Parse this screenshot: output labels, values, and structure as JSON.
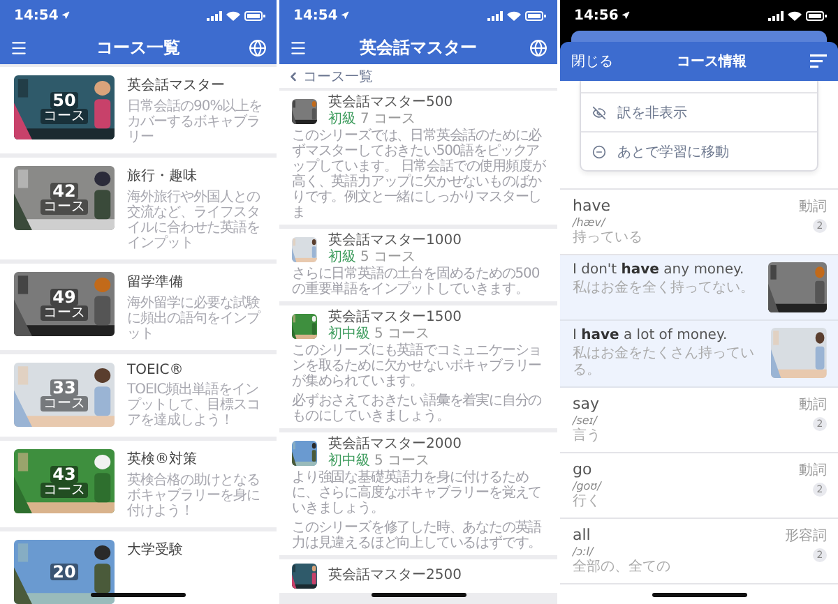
{
  "course_list": {
    "status_bar": {
      "time": "14:54"
    },
    "header": {
      "title": "コース一覧"
    },
    "courses": [
      {
        "title": "英会話マスター",
        "description": "日常会話の90%以上をカバーするボキャブラリー",
        "count": "50",
        "unit": "コース"
      },
      {
        "title": "旅行・趣味",
        "description": "海外旅行や外国人との交流など、ライフスタイルに合わせた英語をインプット",
        "count": "42",
        "unit": "コース"
      },
      {
        "title": "留学準備",
        "description": "海外留学に必要な試験に頻出の語句をインプット",
        "count": "49",
        "unit": "コース"
      },
      {
        "title": "TOEIC®",
        "description": "TOEIC頻出単語をインプットして、目標スコアを達成しよう！",
        "count": "33",
        "unit": "コース"
      },
      {
        "title": "英検®対策",
        "description": "英検合格の助けとなるボキャブラリーを身に付けよう！",
        "count": "43",
        "unit": "コース"
      },
      {
        "title": "大学受験",
        "count": "20"
      }
    ]
  },
  "series_screen": {
    "status_bar": {
      "time": "14:54"
    },
    "header": {
      "title": "英会話マスター"
    },
    "back_link": "コース一覧",
    "series": [
      {
        "title": "英会話マスター500",
        "level": "初級",
        "count": "7 コース",
        "paragraphs": [
          "このシリーズでは、日常英会話のために必ずマスターしておきたい500語をピックアップしています。 日常会話での使用頻度が高く、英語力アップに欠かせないものばかりです。例文と一緒にしっかりマスターしま"
        ]
      },
      {
        "title": "英会話マスター1000",
        "level": "初級",
        "count": "5 コース",
        "paragraphs": [
          "さらに日常英語の土台を固めるための500の重要単語をインプットしていきます。"
        ]
      },
      {
        "title": "英会話マスター1500",
        "level": "初中級",
        "count": "5 コース",
        "paragraphs": [
          "このシリーズにも英語でコミュニケーションを取るために欠かせないボキャブラリーが集められています。",
          "必ずおさえておきたい語彙を着実に自分のものにしていきましょう。"
        ]
      },
      {
        "title": "英会話マスター2000",
        "level": "初中級",
        "count": "5 コース",
        "paragraphs": [
          "より強固な基礎英語力を身に付けるために、さらに高度なボキャブラリーを覚えていきましょう。",
          "このシリーズを修了した時、あなたの英語力は見違えるほど向上しているはずです。"
        ]
      },
      {
        "title": "英会話マスター2500"
      }
    ]
  },
  "course_info": {
    "status_bar": {
      "time": "14:56"
    },
    "header": {
      "close": "閉じる",
      "title": "コース情報"
    },
    "menu_items": [
      {
        "kind": "hide",
        "label": "訳を非表示"
      },
      {
        "kind": "later",
        "label": "あとで学習に移動"
      }
    ],
    "entries": [
      {
        "kind": "word",
        "word": "have",
        "phonetic": "/hæv/",
        "meaning": "持っている",
        "pos": "動詞",
        "badge": "2"
      },
      {
        "kind": "example",
        "text": "I don't **have** any money.",
        "translation": "私はお金を全く持ってない。"
      },
      {
        "kind": "example",
        "text": "I **have** a lot of money.",
        "translation": "私はお金をたくさん持っている。"
      },
      {
        "kind": "word",
        "word": "say",
        "phonetic": "/seɪ/",
        "meaning": "言う",
        "pos": "動詞",
        "badge": "2"
      },
      {
        "kind": "word",
        "word": "go",
        "phonetic": "/goʊ/",
        "meaning": "行く",
        "pos": "動詞",
        "badge": "2"
      },
      {
        "kind": "word",
        "word": "all",
        "phonetic": "/ɔːl/",
        "meaning": "全部の、全ての",
        "pos": "形容詞",
        "badge": "2"
      }
    ]
  }
}
